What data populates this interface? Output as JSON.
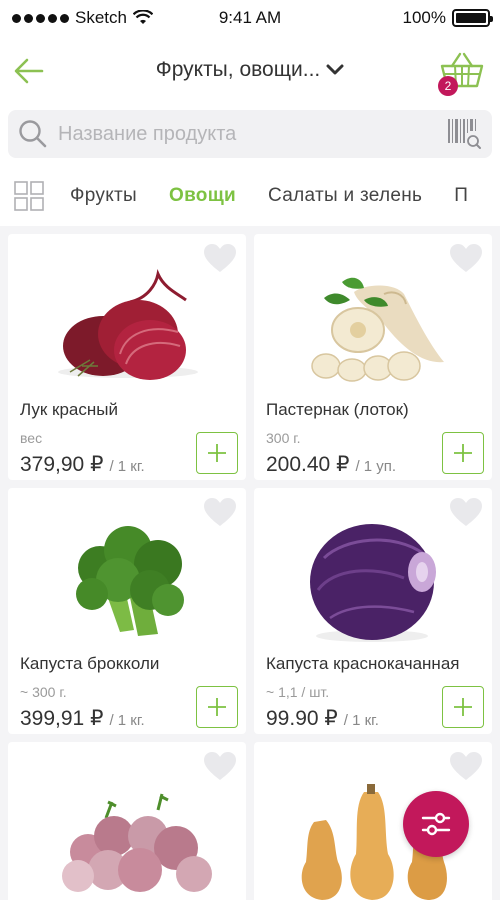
{
  "status_bar": {
    "carrier": "Sketch",
    "time": "9:41 AM",
    "battery": "100%"
  },
  "header": {
    "title": "Фрукты, овощи...",
    "cart_count": "2"
  },
  "search": {
    "placeholder": "Название продукта",
    "value": ""
  },
  "categories": {
    "tabs": [
      "Фрукты",
      "Овощи",
      "Салаты и зелень",
      "П"
    ],
    "active_index": 1
  },
  "products": [
    {
      "name": "Лук красный",
      "unit": "вес",
      "price": "379,90 ₽",
      "per": "/ 1 кг.",
      "image": "red-onion"
    },
    {
      "name": "Пастернак (лоток)",
      "unit": "300 г.",
      "price": "200.40 ₽",
      "per": "/ 1 уп.",
      "image": "parsnip"
    },
    {
      "name": "Капуста брокколи",
      "unit": "~ 300 г.",
      "price": "399,91 ₽",
      "per": "/ 1 кг.",
      "image": "broccoli"
    },
    {
      "name": "Капуста краснокачанная",
      "unit": "~ 1,1 / шт.",
      "price": "99.90 ₽",
      "per": "/ 1 кг.",
      "image": "red-cabbage"
    },
    {
      "name": "",
      "unit": "",
      "price": "",
      "per": "",
      "image": "turnips"
    },
    {
      "name": "",
      "unit": "",
      "price": "",
      "per": "",
      "image": "butternut-squash"
    }
  ],
  "colors": {
    "accent_green": "#7dc242",
    "accent_magenta": "#c2185b",
    "background": "#f4f4f6"
  },
  "icons": {
    "back": "arrow-left-icon",
    "dropdown": "chevron-down-icon",
    "cart": "basket-icon",
    "search": "search-icon",
    "barcode": "barcode-icon",
    "grid": "grid-icon",
    "favorite": "heart-icon",
    "add": "plus-icon",
    "filter": "sliders-icon"
  }
}
